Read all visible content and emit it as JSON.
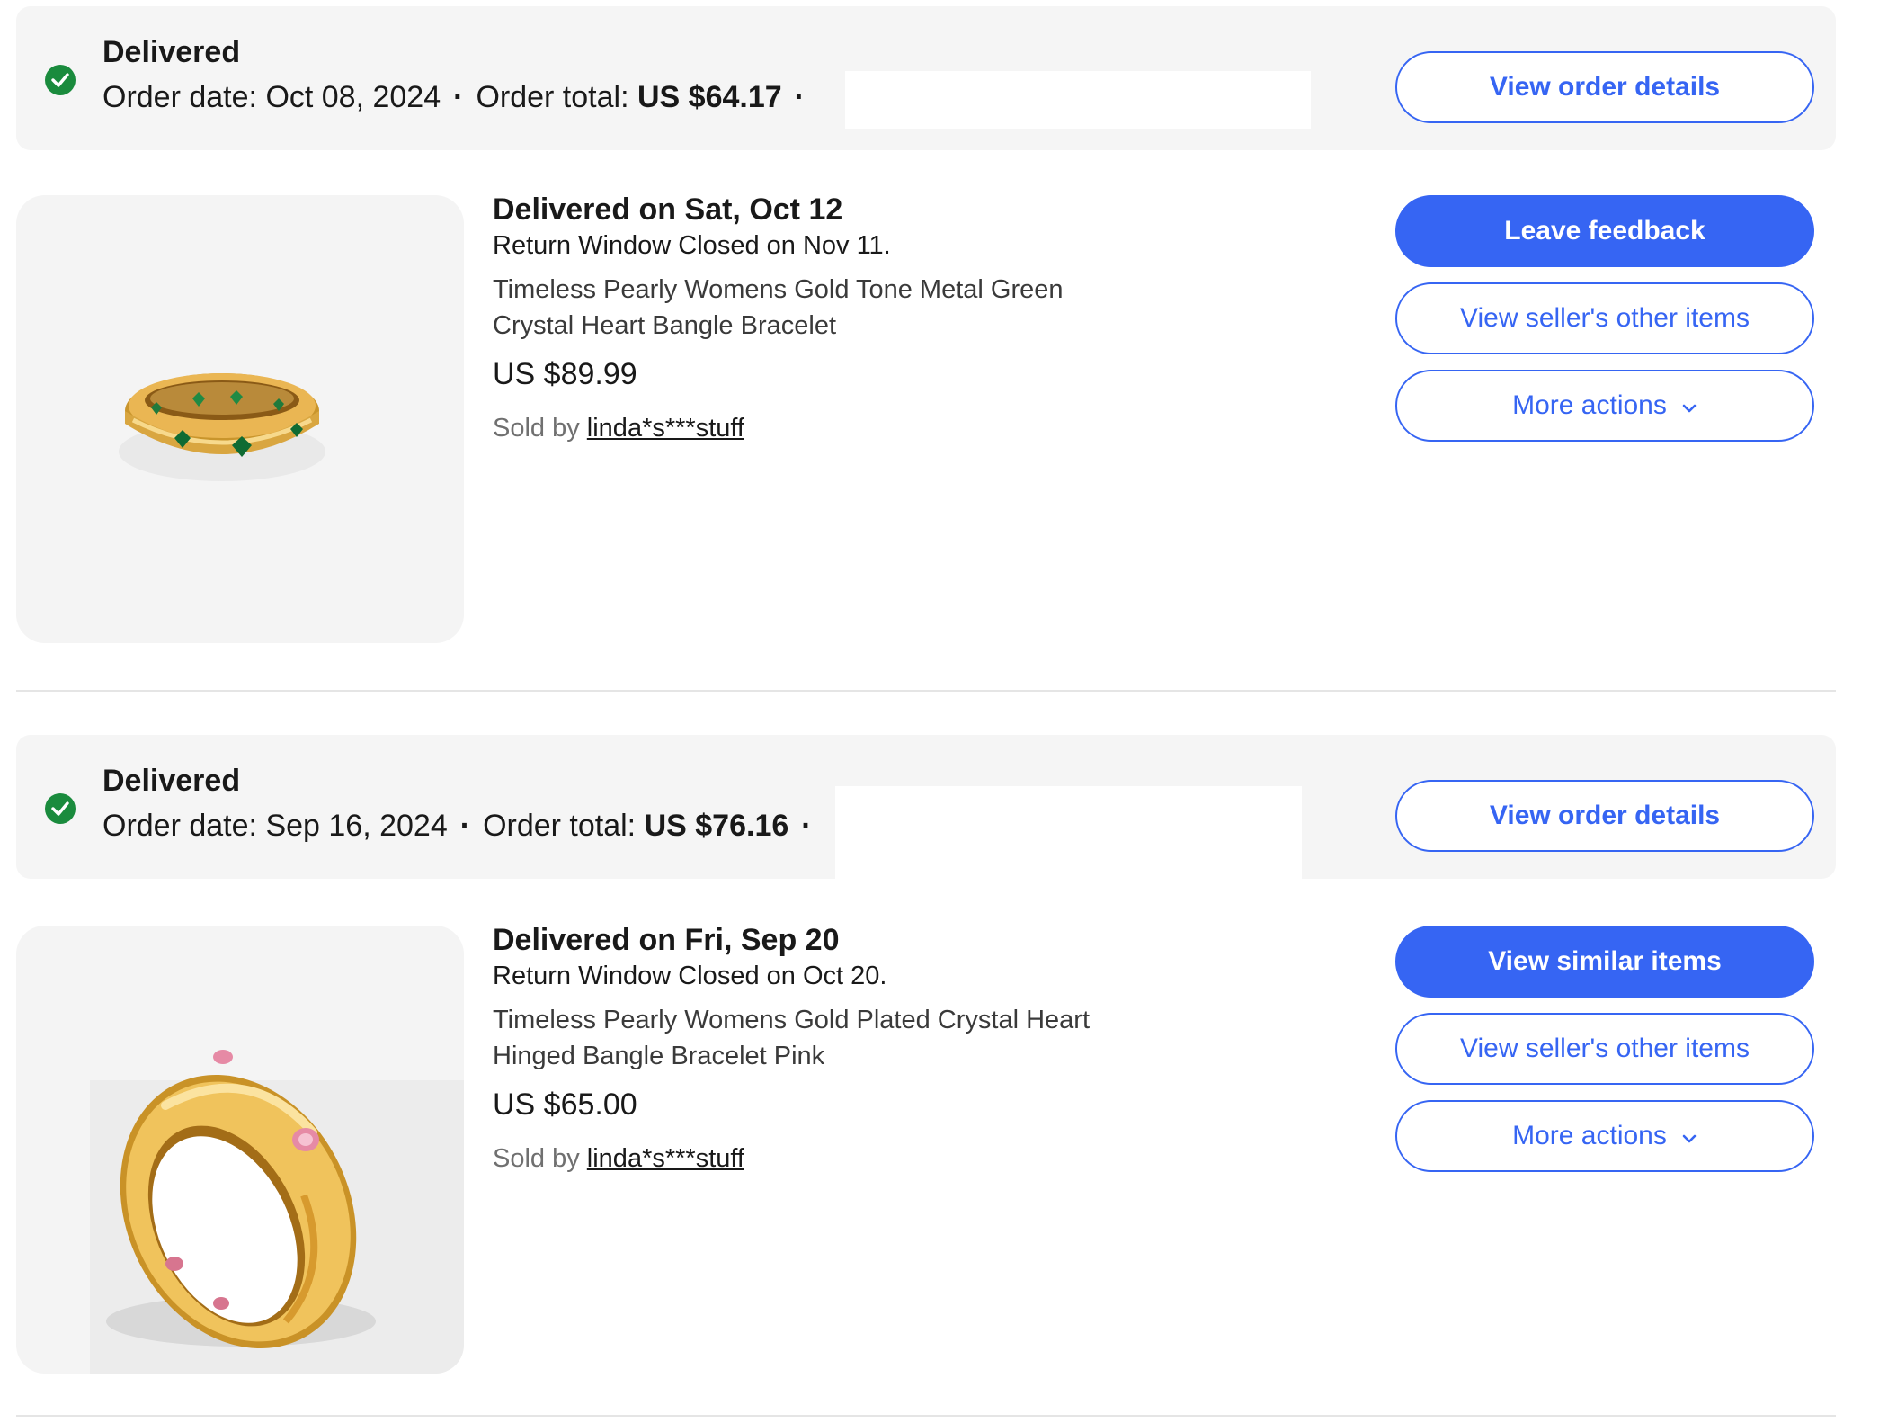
{
  "orders": [
    {
      "status": "Delivered",
      "order_date_label": "Order date:",
      "order_date": "Oct 08, 2024",
      "order_total_label": "Order total:",
      "order_total": "US $64.17",
      "view_order_details": "View order details",
      "delivered_on": "Delivered on Sat, Oct 12",
      "return_window": "Return Window Closed on Nov 11.",
      "product_name": "Timeless Pearly Womens Gold Tone Metal Green Crystal Heart Bangle Bracelet",
      "price": "US $89.99",
      "sold_by_label": "Sold by",
      "seller": "linda*s***stuff",
      "primary_action": "Leave feedback",
      "seller_items": "View seller's other items",
      "more_actions": "More actions"
    },
    {
      "status": "Delivered",
      "order_date_label": "Order date:",
      "order_date": "Sep 16, 2024",
      "order_total_label": "Order total:",
      "order_total": "US $76.16",
      "view_order_details": "View order details",
      "delivered_on": "Delivered on Fri, Sep 20",
      "return_window": "Return Window Closed on Oct 20.",
      "product_name": "Timeless Pearly Womens Gold Plated Crystal Heart Hinged Bangle Bracelet Pink",
      "price": "US $65.00",
      "sold_by_label": "Sold by",
      "seller": "linda*s***stuff",
      "primary_action": "View similar items",
      "seller_items": "View seller's other items",
      "more_actions": "More actions"
    }
  ],
  "colors": {
    "accent": "#3665f3",
    "success": "#1a8b3d",
    "header_bg": "#f5f5f5"
  },
  "icons": [
    "check-circle-icon",
    "chevron-down-icon"
  ]
}
